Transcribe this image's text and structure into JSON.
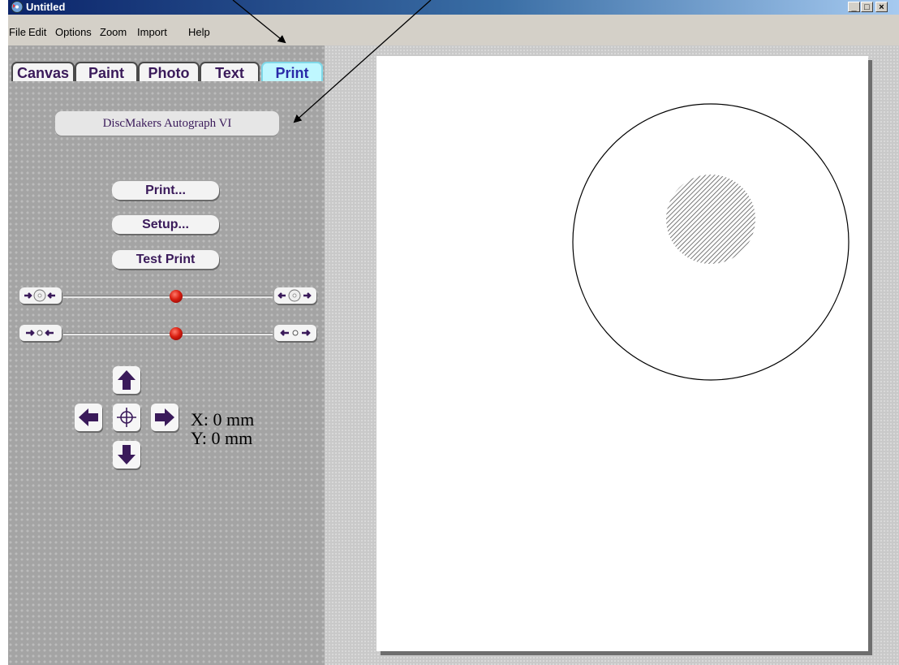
{
  "window": {
    "title": "Untitled",
    "controls": {
      "minimize": "_",
      "maximize": "□",
      "close": "×"
    }
  },
  "menu": [
    "File",
    "Edit",
    "Options",
    "Zoom",
    "Import",
    "Help"
  ],
  "tabs": [
    {
      "label": "Canvas",
      "active": false
    },
    {
      "label": "Paint",
      "active": false
    },
    {
      "label": "Photo",
      "active": false
    },
    {
      "label": "Text",
      "active": false
    },
    {
      "label": "Print",
      "active": true
    }
  ],
  "print_panel": {
    "printer_name": "DiscMakers Autograph VI",
    "buttons": {
      "print": "Print...",
      "setup": "Setup...",
      "test_print": "Test Print"
    },
    "position": {
      "x_readout": "X: 0 mm",
      "y_readout": "Y: 0 mm"
    }
  },
  "icons": {
    "app": "disc-app-icon",
    "slider1_left": "shrink-disc-icon",
    "slider1_right": "enlarge-disc-icon",
    "slider2_left": "shrink-hole-icon",
    "slider2_right": "enlarge-hole-icon",
    "up": "arrow-up-icon",
    "down": "arrow-down-icon",
    "left": "arrow-left-icon",
    "right": "arrow-right-icon",
    "center": "crosshair-icon"
  },
  "colors": {
    "accent": "#3a1a5a",
    "active_tab": "#bff7ff",
    "knob": "#d81e10",
    "title_bar": "#0b246a"
  }
}
